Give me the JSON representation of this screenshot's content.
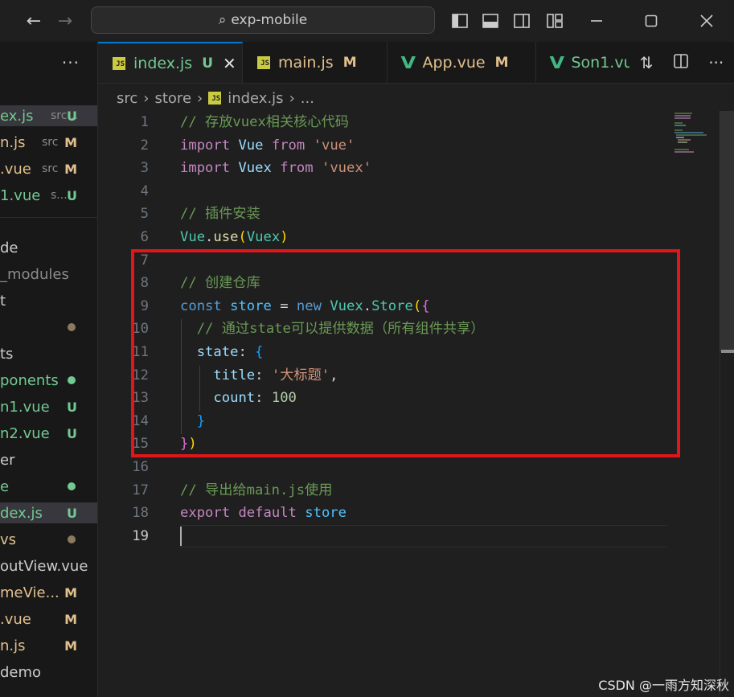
{
  "titlebar": {
    "search_text": "exp-mobile",
    "back_icon": "arrow-left-icon",
    "forward_icon": "arrow-right-icon"
  },
  "sidebar": {
    "more": "···",
    "items": [
      {
        "name": "ex.js",
        "sub": "src...",
        "badge": "U",
        "color": "#73c991",
        "selected": true
      },
      {
        "name": "n.js",
        "sub": "src",
        "badge": "M",
        "color": "#e2c08d"
      },
      {
        "name": ".vue",
        "sub": "src",
        "badge": "M",
        "color": "#e2c08d"
      },
      {
        "name": "1.vue",
        "sub": "s...",
        "badge": "U",
        "color": "#73c991"
      },
      {
        "name": "de",
        "color": "#cccccc"
      },
      {
        "name": "_modules",
        "color": "#8b8b8b"
      },
      {
        "name": "t",
        "color": "#cccccc"
      },
      {
        "name": "",
        "dot": "#8c7a5e"
      },
      {
        "name": "ts",
        "color": "#cccccc"
      },
      {
        "name": "ponents",
        "color": "#73c991",
        "dot": "#73c991"
      },
      {
        "name": "n1.vue",
        "badge": "U",
        "color": "#73c991"
      },
      {
        "name": "n2.vue",
        "badge": "U",
        "color": "#73c991"
      },
      {
        "name": "er",
        "color": "#cccccc"
      },
      {
        "name": "e",
        "color": "#73c991",
        "dot": "#73c991"
      },
      {
        "name": "dex.js",
        "badge": "U",
        "color": "#73c991",
        "selected": true
      },
      {
        "name": "vs",
        "color": "#e2c08d",
        "dot": "#8c7a5e"
      },
      {
        "name": "outView.vue",
        "color": "#cccccc"
      },
      {
        "name": "meVie...",
        "badge": "M",
        "color": "#e2c08d"
      },
      {
        "name": ".vue",
        "badge": "M",
        "color": "#e2c08d"
      },
      {
        "name": "n.js",
        "badge": "M",
        "color": "#e2c08d"
      },
      {
        "name": "demo",
        "color": "#cccccc"
      }
    ]
  },
  "tabs": [
    {
      "label": "index.js",
      "badge": "U",
      "icon": "js-icon",
      "active": true,
      "close": "✕"
    },
    {
      "label": "main.js",
      "badge": "M",
      "icon": "js-icon"
    },
    {
      "label": "App.vue",
      "badge": "M",
      "icon": "vue-icon"
    },
    {
      "label": "Son1.vu",
      "badge": "",
      "icon": "vue-icon"
    }
  ],
  "breadcrumb": [
    "src",
    "store",
    "index.js",
    "..."
  ],
  "editor": {
    "current_line": 19,
    "lines": [
      [
        [
          "c-cmt",
          "// 存放vuex相关核心代码"
        ]
      ],
      [
        [
          "c-kw",
          "import"
        ],
        [
          "c-txt",
          " "
        ],
        [
          "c-var",
          "Vue"
        ],
        [
          "c-txt",
          " "
        ],
        [
          "c-kw",
          "from"
        ],
        [
          "c-txt",
          " "
        ],
        [
          "c-str",
          "'vue'"
        ]
      ],
      [
        [
          "c-kw",
          "import"
        ],
        [
          "c-txt",
          " "
        ],
        [
          "c-var",
          "Vuex"
        ],
        [
          "c-txt",
          " "
        ],
        [
          "c-kw",
          "from"
        ],
        [
          "c-txt",
          " "
        ],
        [
          "c-str",
          "'vuex'"
        ]
      ],
      [],
      [
        [
          "c-cmt",
          "// 插件安装"
        ]
      ],
      [
        [
          "c-cls",
          "Vue"
        ],
        [
          "c-txt",
          "."
        ],
        [
          "c-fn",
          "use"
        ],
        [
          "c-p1",
          "("
        ],
        [
          "c-cls",
          "Vuex"
        ],
        [
          "c-p1",
          ")"
        ]
      ],
      [],
      [
        [
          "c-cmt",
          "// 创建仓库"
        ]
      ],
      [
        [
          "c-decl",
          "const"
        ],
        [
          "c-txt",
          " "
        ],
        [
          "c-const",
          "store"
        ],
        [
          "c-txt",
          " = "
        ],
        [
          "c-decl",
          "new"
        ],
        [
          "c-txt",
          " "
        ],
        [
          "c-cls",
          "Vuex"
        ],
        [
          "c-txt",
          "."
        ],
        [
          "c-cls",
          "Store"
        ],
        [
          "c-p1",
          "("
        ],
        [
          "c-p2",
          "{"
        ]
      ],
      [
        [
          "c-txt",
          "  "
        ],
        [
          "c-cmt",
          "// 通过state可以提供数据（所有组件共享）"
        ]
      ],
      [
        [
          "c-txt",
          "  "
        ],
        [
          "c-var",
          "state"
        ],
        [
          "c-txt",
          ": "
        ],
        [
          "c-p3",
          "{"
        ]
      ],
      [
        [
          "c-txt",
          "    "
        ],
        [
          "c-var",
          "title"
        ],
        [
          "c-txt",
          ": "
        ],
        [
          "c-str",
          "'大标题'"
        ],
        [
          "c-txt",
          ","
        ]
      ],
      [
        [
          "c-txt",
          "    "
        ],
        [
          "c-var",
          "count"
        ],
        [
          "c-txt",
          ": "
        ],
        [
          "c-num",
          "100"
        ]
      ],
      [
        [
          "c-txt",
          "  "
        ],
        [
          "c-p3",
          "}"
        ]
      ],
      [
        [
          "c-p2",
          "}"
        ],
        [
          "c-p1",
          ")"
        ]
      ],
      [],
      [
        [
          "c-cmt",
          "// 导出给main.js使用"
        ]
      ],
      [
        [
          "c-kw",
          "export"
        ],
        [
          "c-txt",
          " "
        ],
        [
          "c-kw",
          "default"
        ],
        [
          "c-txt",
          " "
        ],
        [
          "c-const",
          "store"
        ]
      ],
      []
    ]
  },
  "watermark": "CSDN @一雨方知深秋",
  "colors": {
    "accent": "#0078d4",
    "highlight_box": "#e0161b"
  }
}
